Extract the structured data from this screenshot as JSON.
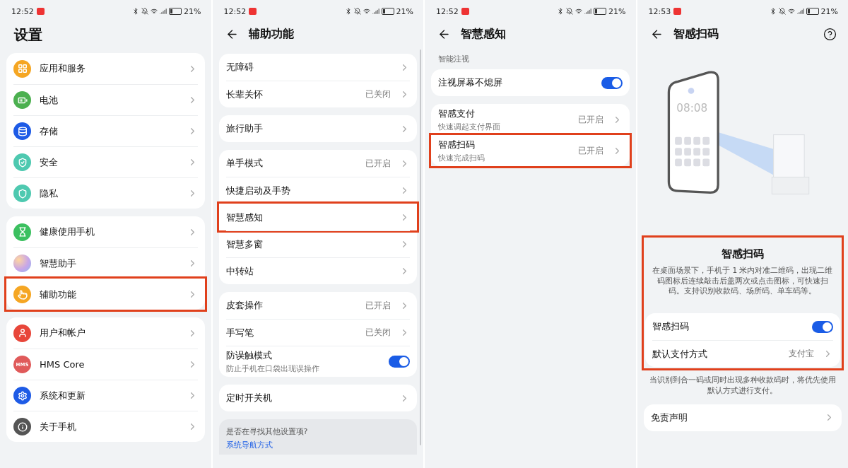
{
  "panels": [
    {
      "status": {
        "time": "12:52",
        "battery": "21%"
      },
      "header": {
        "title": "设置",
        "back": false,
        "help": false
      },
      "blocks": [
        {
          "kind": "group",
          "items": [
            {
              "label": "应用和服务",
              "color": "#f5a623",
              "highlighted": false
            },
            {
              "label": "电池",
              "color": "#4cb050",
              "highlighted": false
            },
            {
              "label": "存储",
              "color": "#1e5be6",
              "highlighted": false
            },
            {
              "label": "安全",
              "color": "#4ec9b0",
              "highlighted": false
            },
            {
              "label": "隐私",
              "color": "#4ec9b0",
              "highlighted": false
            }
          ]
        },
        {
          "kind": "group",
          "items": [
            {
              "label": "健康使用手机",
              "color": "#3cc060",
              "highlighted": false
            },
            {
              "label": "智慧助手",
              "color": "#c8a6e8",
              "highlighted": false
            },
            {
              "label": "辅助功能",
              "color": "#f5a623",
              "highlighted": true
            }
          ]
        },
        {
          "kind": "group",
          "items": [
            {
              "label": "用户和帐户",
              "color": "#e8463a",
              "highlighted": false
            },
            {
              "label": "HMS Core",
              "color": "#e05a5a",
              "icon_text": "HMS",
              "highlighted": false
            },
            {
              "label": "系统和更新",
              "color": "#1e5be6",
              "highlighted": false
            },
            {
              "label": "关于手机",
              "color": "#555555",
              "highlighted": false
            }
          ]
        }
      ]
    },
    {
      "status": {
        "time": "12:52",
        "battery": "21%"
      },
      "header": {
        "title": "辅助功能",
        "back": true,
        "help": false
      },
      "blocks": [
        {
          "kind": "group",
          "items": [
            {
              "label": "无障碍",
              "highlighted": false
            },
            {
              "label": "长辈关怀",
              "value": "已关闭",
              "highlighted": false
            }
          ]
        },
        {
          "kind": "group",
          "items": [
            {
              "label": "旅行助手",
              "highlighted": false
            }
          ]
        },
        {
          "kind": "group",
          "items": [
            {
              "label": "单手模式",
              "value": "已开启",
              "highlighted": false
            },
            {
              "label": "快捷启动及手势",
              "highlighted": false
            },
            {
              "label": "智慧感知",
              "highlighted": true
            },
            {
              "label": "智慧多窗",
              "highlighted": false
            },
            {
              "label": "中转站",
              "highlighted": false
            }
          ]
        },
        {
          "kind": "group",
          "items": [
            {
              "label": "皮套操作",
              "value": "已开启",
              "highlighted": false
            },
            {
              "label": "手写笔",
              "value": "已关闭",
              "highlighted": false
            },
            {
              "label": "防误触模式",
              "sub": "防止手机在口袋出现误操作",
              "on": true,
              "highlighted": false
            }
          ]
        },
        {
          "kind": "group",
          "items": [
            {
              "label": "定时开关机",
              "highlighted": false
            }
          ]
        },
        {
          "kind": "hint",
          "text": "是否在寻找其他设置项?",
          "link": "系统导航方式"
        }
      ]
    },
    {
      "status": {
        "time": "12:52",
        "battery": "21%"
      },
      "header": {
        "title": "智慧感知",
        "back": true,
        "help": false
      },
      "blocks": [
        {
          "kind": "label",
          "text": "智能注视"
        },
        {
          "kind": "group",
          "items": [
            {
              "label": "注视屏幕不熄屏",
              "on": true,
              "highlighted": false
            }
          ]
        },
        {
          "kind": "group",
          "items": [
            {
              "label": "智感支付",
              "sub": "快速调起支付界面",
              "value": "已开启",
              "highlighted": false
            },
            {
              "label": "智感扫码",
              "sub": "快速完成扫码",
              "value": "已开启",
              "highlighted": true
            }
          ]
        }
      ]
    },
    {
      "status": {
        "time": "12:53",
        "battery": "21%"
      },
      "header": {
        "title": "智感扫码",
        "back": true,
        "help": true
      },
      "blocks": [
        {
          "kind": "illustration",
          "screen_time": "08:08"
        },
        {
          "kind": "feature",
          "title": "智感扫码",
          "description": "在桌面场景下，手机于 1 米内对准二维码，出现二维码图标后连续敲击后盖两次或点击图标，可快速扫码。支持识别收款码、场所码、单车码等。",
          "highlighted": true,
          "items": [
            {
              "label": "智感扫码",
              "on": true
            },
            {
              "label": "默认支付方式",
              "value": "支付宝"
            }
          ]
        },
        {
          "kind": "note",
          "text": "当识别到合一码或同时出现多种收款码时，将优先使用默认方式进行支付。"
        },
        {
          "kind": "group",
          "items": [
            {
              "label": "免责声明",
              "highlighted": false
            }
          ]
        }
      ]
    }
  ]
}
